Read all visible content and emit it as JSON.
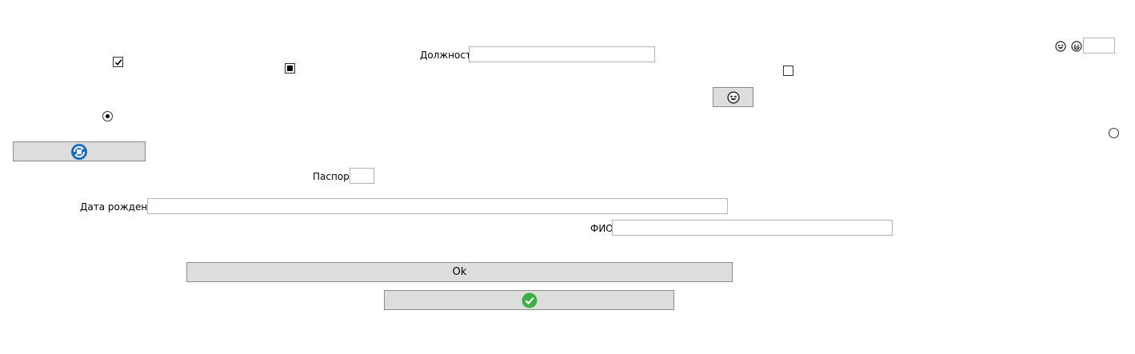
{
  "form": {
    "position_label": "Должность",
    "position_value": "",
    "passport_label": "Паспорт",
    "passport_value": "",
    "birthdate_label": "Дата рождения",
    "birthdate_value": "",
    "fio_label": "ФИО",
    "fio_value": "",
    "top_right_value": "",
    "ok_label": "Ok"
  },
  "checkboxes": [
    {
      "state": "checked"
    },
    {
      "state": "indeterminate"
    },
    {
      "state": "unchecked"
    }
  ],
  "radios": [
    {
      "state": "selected"
    },
    {
      "state": "unselected"
    }
  ],
  "icons": {
    "refresh_button_icon": "refresh-icon",
    "confirm_button_icon": "checkmark-icon",
    "emoji_button_icon": "laughing-face-icon",
    "top_right_emojis": [
      "laughing-face-icon",
      "grinning-face-icon"
    ]
  },
  "colors": {
    "button_bg": "#dddddd",
    "button_border": "#8c8c8c",
    "input_border": "#b4b4b4",
    "refresh_icon_blue": "#1a6fc4",
    "check_icon_green": "#3cb043"
  }
}
